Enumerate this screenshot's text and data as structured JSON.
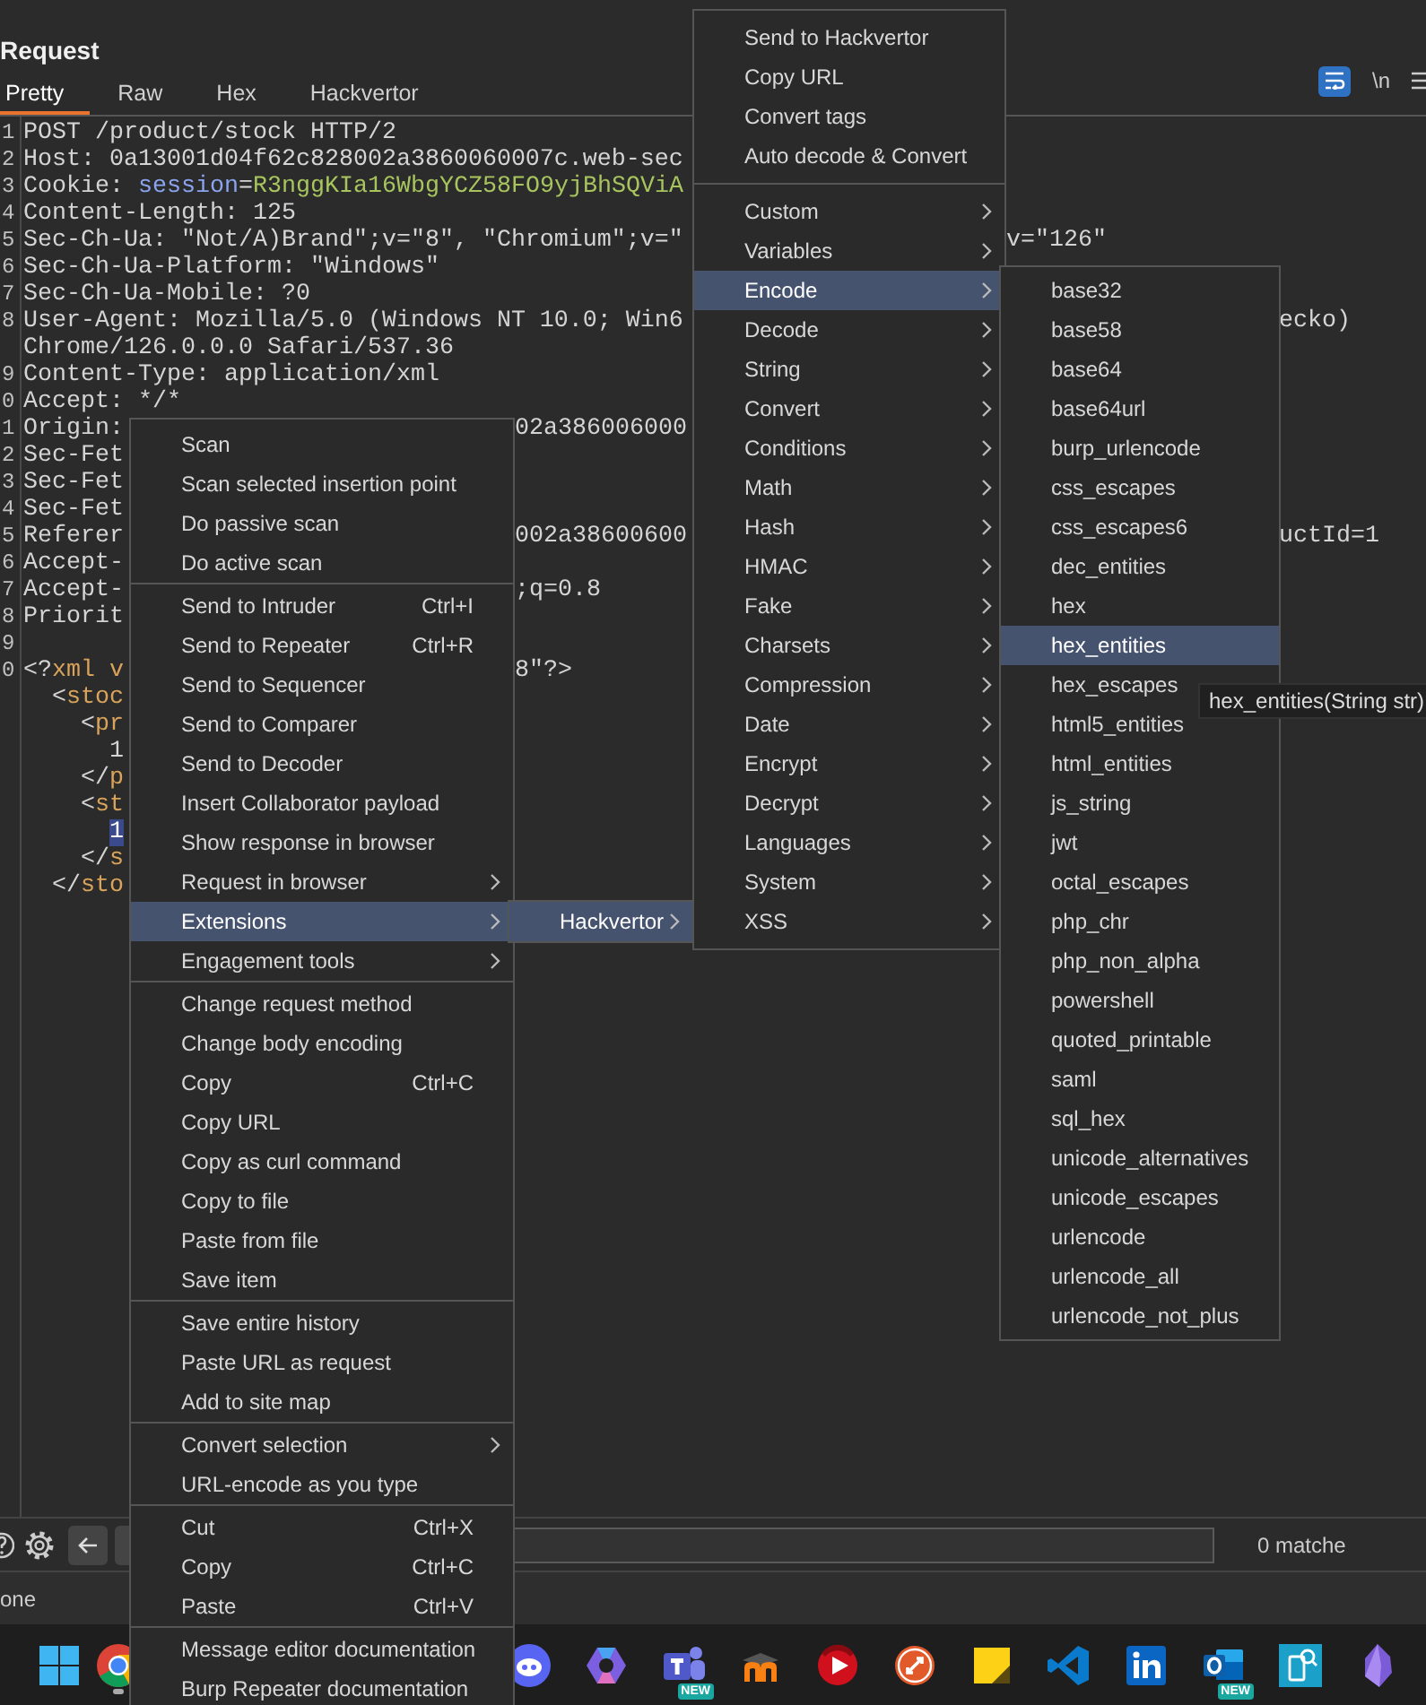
{
  "panel": {
    "title": "Request"
  },
  "tabs": [
    {
      "label": "Pretty",
      "selected": true
    },
    {
      "label": "Raw",
      "selected": false
    },
    {
      "label": "Hex",
      "selected": false
    },
    {
      "label": "Hackvertor",
      "selected": false
    }
  ],
  "view_options": {
    "wrap_on": true,
    "newline_label": "\\n"
  },
  "editor": {
    "lines": [
      {
        "number": "1",
        "segments": [
          {
            "text": "POST /product/stock HTTP/2",
            "kind": "plain"
          }
        ]
      },
      {
        "number": "2",
        "segments": [
          {
            "text": "Host: 0a13001d04f62c828002a3860060007c.web-sec",
            "kind": "plain"
          }
        ]
      },
      {
        "number": "3",
        "segments": [
          {
            "text": "Cookie: ",
            "kind": "plain"
          },
          {
            "text": "session",
            "kind": "attr"
          },
          {
            "text": "=",
            "kind": "plain"
          },
          {
            "text": "R3nggKIa16WbgYCZ58FO9yjBhSQViA",
            "kind": "value"
          }
        ]
      },
      {
        "number": "4",
        "segments": [
          {
            "text": "Content-Length: 125",
            "kind": "plain"
          }
        ]
      },
      {
        "number": "5",
        "segments": [
          {
            "text": "Sec-Ch-Ua: \"Not/A)Brand\";v=\"8\", \"Chromium\";v=\"",
            "kind": "plain"
          }
        ],
        "after_main_menu": "v=\"126\""
      },
      {
        "number": "6",
        "segments": [
          {
            "text": "Sec-Ch-Ua-Platform: \"Windows\"",
            "kind": "plain"
          }
        ]
      },
      {
        "number": "7",
        "segments": [
          {
            "text": "Sec-Ch-Ua-Mobile: ?0",
            "kind": "plain"
          }
        ]
      },
      {
        "number": "8",
        "segments": [
          {
            "text": "User-Agent: Mozilla/5.0 (Windows NT 10.0; Win6",
            "kind": "plain"
          }
        ],
        "after_encode_menu": "ecko)"
      },
      {
        "segments": [
          {
            "text": "Chrome/126.0.0.0 Safari/537.36",
            "kind": "plain"
          }
        ]
      },
      {
        "number": "9",
        "segments": [
          {
            "text": "Content-Type: application/xml",
            "kind": "plain"
          }
        ]
      },
      {
        "number": "0",
        "segments": [
          {
            "text": "Accept: */*",
            "kind": "plain"
          }
        ]
      },
      {
        "number": "1",
        "segments": [
          {
            "text": "Origin:",
            "kind": "plain"
          }
        ],
        "after_context_menu": "02a386006000"
      },
      {
        "number": "2",
        "segments": [
          {
            "text": "Sec-Fet",
            "kind": "plain"
          }
        ]
      },
      {
        "number": "3",
        "segments": [
          {
            "text": "Sec-Fet",
            "kind": "plain"
          }
        ]
      },
      {
        "number": "4",
        "segments": [
          {
            "text": "Sec-Fet",
            "kind": "plain"
          }
        ]
      },
      {
        "number": "5",
        "segments": [
          {
            "text": "Referer",
            "kind": "plain"
          }
        ],
        "after_context_menu": "002a38600600",
        "after_encode_menu": "uctId=1"
      },
      {
        "number": "6",
        "segments": [
          {
            "text": "Accept-",
            "kind": "plain"
          }
        ]
      },
      {
        "number": "7",
        "segments": [
          {
            "text": "Accept-",
            "kind": "plain"
          }
        ],
        "after_context_menu": ";q=0.8"
      },
      {
        "number": "8",
        "segments": [
          {
            "text": "Priorit",
            "kind": "plain"
          }
        ]
      },
      {
        "number": "9"
      },
      {
        "number": "0",
        "segments": [
          {
            "text": "<?",
            "kind": "plain"
          },
          {
            "text": "xml v",
            "kind": "tag"
          }
        ],
        "after_context_menu": "8\"?>"
      },
      {
        "segments": [
          {
            "text": "  <",
            "kind": "plain"
          },
          {
            "text": "stoc",
            "kind": "tag"
          }
        ]
      },
      {
        "segments": [
          {
            "text": "    <",
            "kind": "plain"
          },
          {
            "text": "pr",
            "kind": "tag"
          }
        ]
      },
      {
        "segments": [
          {
            "text": "      1",
            "kind": "plain"
          }
        ]
      },
      {
        "segments": [
          {
            "text": "    </",
            "kind": "plain"
          },
          {
            "text": "p",
            "kind": "tag"
          }
        ]
      },
      {
        "segments": [
          {
            "text": "    <",
            "kind": "plain"
          },
          {
            "text": "st",
            "kind": "tag"
          }
        ]
      },
      {
        "segments": [
          {
            "text": "      1",
            "kind": "selection"
          }
        ]
      },
      {
        "segments": [
          {
            "text": "    </",
            "kind": "plain"
          },
          {
            "text": "s",
            "kind": "tag"
          }
        ]
      },
      {
        "segments": [
          {
            "text": "  </",
            "kind": "plain"
          },
          {
            "text": "sto",
            "kind": "tag"
          }
        ]
      }
    ]
  },
  "context_menu": {
    "groups": [
      [
        {
          "label": "Scan",
          "submenu": false,
          "selected": false
        },
        {
          "label": "Scan selected insertion point",
          "submenu": false,
          "selected": false
        },
        {
          "label": "Do passive scan",
          "submenu": false,
          "selected": false
        },
        {
          "label": "Do active scan",
          "submenu": false,
          "selected": false
        }
      ],
      [
        {
          "label": "Send to Intruder",
          "shortcut": "Ctrl+I",
          "submenu": false,
          "selected": false
        },
        {
          "label": "Send to Repeater",
          "shortcut": "Ctrl+R",
          "submenu": false,
          "selected": false
        },
        {
          "label": "Send to Sequencer",
          "submenu": false,
          "selected": false
        },
        {
          "label": "Send to Comparer",
          "submenu": false,
          "selected": false
        },
        {
          "label": "Send to Decoder",
          "submenu": false,
          "selected": false
        },
        {
          "label": "Insert Collaborator payload",
          "submenu": false,
          "selected": false
        },
        {
          "label": "Show response in browser",
          "submenu": false,
          "selected": false
        },
        {
          "label": "Request in browser",
          "submenu": true,
          "selected": false
        },
        {
          "label": "Extensions",
          "submenu": true,
          "selected": true
        },
        {
          "label": "Engagement tools",
          "submenu": true,
          "selected": false
        }
      ],
      [
        {
          "label": "Change request method",
          "submenu": false,
          "selected": false
        },
        {
          "label": "Change body encoding",
          "submenu": false,
          "selected": false
        },
        {
          "label": "Copy",
          "shortcut": "Ctrl+C",
          "submenu": false,
          "selected": false
        },
        {
          "label": "Copy URL",
          "submenu": false,
          "selected": false
        },
        {
          "label": "Copy as curl command",
          "submenu": false,
          "selected": false
        },
        {
          "label": "Copy to file",
          "submenu": false,
          "selected": false
        },
        {
          "label": "Paste from file",
          "submenu": false,
          "selected": false
        },
        {
          "label": "Save item",
          "submenu": false,
          "selected": false
        }
      ],
      [
        {
          "label": "Save entire history",
          "submenu": false,
          "selected": false
        },
        {
          "label": "Paste URL as request",
          "submenu": false,
          "selected": false
        },
        {
          "label": "Add to site map",
          "submenu": false,
          "selected": false
        }
      ],
      [
        {
          "label": "Convert selection",
          "submenu": true,
          "selected": false
        },
        {
          "label": "URL-encode as you type",
          "submenu": false,
          "selected": false
        }
      ],
      [
        {
          "label": "Cut",
          "shortcut": "Ctrl+X",
          "submenu": false,
          "selected": false
        },
        {
          "label": "Copy",
          "shortcut": "Ctrl+C",
          "submenu": false,
          "selected": false
        },
        {
          "label": "Paste",
          "shortcut": "Ctrl+V",
          "submenu": false,
          "selected": false
        }
      ],
      [
        {
          "label": "Message editor documentation",
          "submenu": false,
          "selected": false
        },
        {
          "label": "Burp Repeater documentation",
          "submenu": false,
          "selected": false
        }
      ]
    ]
  },
  "extensions_submenu": {
    "groups": [
      [
        {
          "label": "Hackvertor",
          "submenu": true,
          "selected": true
        }
      ]
    ]
  },
  "hackvertor_menu": {
    "groups": [
      [
        {
          "label": "Send to Hackvertor",
          "submenu": false,
          "selected": false
        },
        {
          "label": "Copy URL",
          "submenu": false,
          "selected": false
        },
        {
          "label": "Convert tags",
          "submenu": false,
          "selected": false
        },
        {
          "label": "Auto decode & Convert",
          "submenu": false,
          "selected": false
        }
      ],
      [
        {
          "label": "Custom",
          "submenu": true,
          "selected": false
        },
        {
          "label": "Variables",
          "submenu": true,
          "selected": false
        },
        {
          "label": "Encode",
          "submenu": true,
          "selected": true
        },
        {
          "label": "Decode",
          "submenu": true,
          "selected": false
        },
        {
          "label": "String",
          "submenu": true,
          "selected": false
        },
        {
          "label": "Convert",
          "submenu": true,
          "selected": false
        },
        {
          "label": "Conditions",
          "submenu": true,
          "selected": false
        },
        {
          "label": "Math",
          "submenu": true,
          "selected": false
        },
        {
          "label": "Hash",
          "submenu": true,
          "selected": false
        },
        {
          "label": "HMAC",
          "submenu": true,
          "selected": false
        },
        {
          "label": "Fake",
          "submenu": true,
          "selected": false
        },
        {
          "label": "Charsets",
          "submenu": true,
          "selected": false
        },
        {
          "label": "Compression",
          "submenu": true,
          "selected": false
        },
        {
          "label": "Date",
          "submenu": true,
          "selected": false
        },
        {
          "label": "Encrypt",
          "submenu": true,
          "selected": false
        },
        {
          "label": "Decrypt",
          "submenu": true,
          "selected": false
        },
        {
          "label": "Languages",
          "submenu": true,
          "selected": false
        },
        {
          "label": "System",
          "submenu": true,
          "selected": false
        },
        {
          "label": "XSS",
          "submenu": true,
          "selected": false
        }
      ]
    ]
  },
  "encode_submenu": {
    "groups": [
      [
        {
          "label": "base32",
          "submenu": false,
          "selected": false
        },
        {
          "label": "base58",
          "submenu": false,
          "selected": false
        },
        {
          "label": "base64",
          "submenu": false,
          "selected": false
        },
        {
          "label": "base64url",
          "submenu": false,
          "selected": false
        },
        {
          "label": "burp_urlencode",
          "submenu": false,
          "selected": false
        },
        {
          "label": "css_escapes",
          "submenu": false,
          "selected": false
        },
        {
          "label": "css_escapes6",
          "submenu": false,
          "selected": false
        },
        {
          "label": "dec_entities",
          "submenu": false,
          "selected": false
        },
        {
          "label": "hex",
          "submenu": false,
          "selected": false
        },
        {
          "label": "hex_entities",
          "submenu": false,
          "selected": true
        },
        {
          "label": "hex_escapes",
          "submenu": false,
          "selected": false
        },
        {
          "label": "html5_entities",
          "submenu": false,
          "selected": false
        },
        {
          "label": "html_entities",
          "submenu": false,
          "selected": false
        },
        {
          "label": "js_string",
          "submenu": false,
          "selected": false
        },
        {
          "label": "jwt",
          "submenu": false,
          "selected": false
        },
        {
          "label": "octal_escapes",
          "submenu": false,
          "selected": false
        },
        {
          "label": "php_chr",
          "submenu": false,
          "selected": false
        },
        {
          "label": "php_non_alpha",
          "submenu": false,
          "selected": false
        },
        {
          "label": "powershell",
          "submenu": false,
          "selected": false
        },
        {
          "label": "quoted_printable",
          "submenu": false,
          "selected": false
        },
        {
          "label": "saml",
          "submenu": false,
          "selected": false
        },
        {
          "label": "sql_hex",
          "submenu": false,
          "selected": false
        },
        {
          "label": "unicode_alternatives",
          "submenu": false,
          "selected": false
        },
        {
          "label": "unicode_escapes",
          "submenu": false,
          "selected": false
        },
        {
          "label": "urlencode",
          "submenu": false,
          "selected": false
        },
        {
          "label": "urlencode_all",
          "submenu": false,
          "selected": false
        },
        {
          "label": "urlencode_not_plus",
          "submenu": false,
          "selected": false
        }
      ]
    ]
  },
  "tooltip": {
    "text": "hex_entities(String str)"
  },
  "search_bar": {
    "matches": "0 matche"
  },
  "status_bar": {
    "text": "one"
  },
  "taskbar": {
    "left": [
      {
        "kind": "windows",
        "running": false
      },
      {
        "kind": "chrome",
        "running": true
      }
    ],
    "right": [
      {
        "kind": "discord",
        "running": false
      },
      {
        "kind": "copilot",
        "running": false
      },
      {
        "kind": "teams",
        "running": false,
        "badge": "NEW"
      },
      {
        "kind": "moodle",
        "running": false
      },
      {
        "kind": "player",
        "running": false
      },
      {
        "kind": "remote",
        "running": false
      },
      {
        "kind": "sticky",
        "running": false
      },
      {
        "kind": "vscode",
        "running": false
      },
      {
        "kind": "linkedin",
        "running": false
      },
      {
        "kind": "outlook",
        "running": false,
        "badge": "NEW"
      },
      {
        "kind": "phone",
        "running": false
      },
      {
        "kind": "crystal",
        "running": false
      }
    ]
  }
}
